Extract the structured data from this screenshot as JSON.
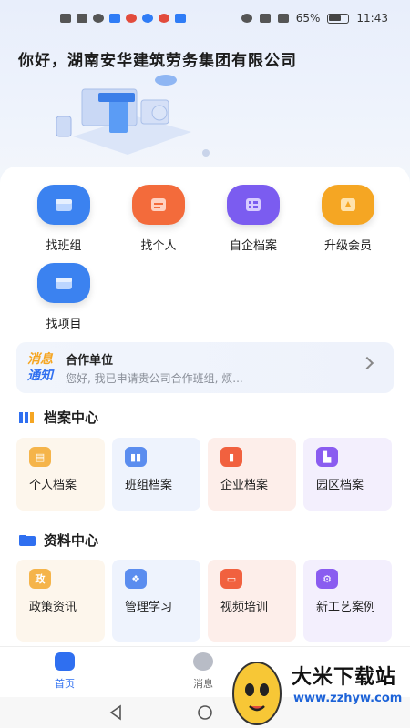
{
  "status_bar": {
    "battery": "65%",
    "time": "11:43"
  },
  "header": {
    "greeting": "你好，湖南安华建筑劳务集团有限公司"
  },
  "quick_actions": [
    {
      "label": "找班组",
      "icon": "team-icon",
      "color": "#3b82f0"
    },
    {
      "label": "找个人",
      "icon": "person-card-icon",
      "color": "#f36b3b"
    },
    {
      "label": "自企档案",
      "icon": "archive-icon",
      "color": "#7b5cf0"
    },
    {
      "label": "升级会员",
      "icon": "vip-icon",
      "color": "#f5a623"
    },
    {
      "label": "找项目",
      "icon": "project-icon",
      "color": "#3b82f0"
    }
  ],
  "notice": {
    "tag_line1": "消息",
    "tag_line2": "通知",
    "title": "合作单位",
    "text": "您好, 我已申请贵公司合作班组, 烦..."
  },
  "archive_center": {
    "title": "档案中心",
    "items": [
      {
        "label": "个人档案",
        "icon": "personal-archive-icon",
        "color": "#f5b44a",
        "bg": "#fdf6ec"
      },
      {
        "label": "班组档案",
        "icon": "team-archive-icon",
        "color": "#5b8def",
        "bg": "#eef3fd"
      },
      {
        "label": "企业档案",
        "icon": "enterprise-archive-icon",
        "color": "#f1613f",
        "bg": "#fdeeea"
      },
      {
        "label": "园区档案",
        "icon": "park-archive-icon",
        "color": "#8a5cf0",
        "bg": "#f3effd"
      }
    ]
  },
  "resource_center": {
    "title": "资料中心",
    "items": [
      {
        "label": "政策资讯",
        "glyph": "政",
        "icon": "policy-icon",
        "color": "#f5b44a",
        "bg": "#fdf6ec"
      },
      {
        "label": "管理学习",
        "glyph": "",
        "icon": "management-icon",
        "color": "#5b8def",
        "bg": "#eef3fd"
      },
      {
        "label": "视频培训",
        "glyph": "",
        "icon": "video-icon",
        "color": "#f1613f",
        "bg": "#fdeeea"
      },
      {
        "label": "新工艺案例",
        "glyph": "",
        "icon": "gear-icon",
        "color": "#8a5cf0",
        "bg": "#f3effd"
      }
    ]
  },
  "tabbar": {
    "home": "首页",
    "messages": "消息"
  },
  "watermark": {
    "name": "大米下载站",
    "url": "www.zzhyw.com"
  }
}
